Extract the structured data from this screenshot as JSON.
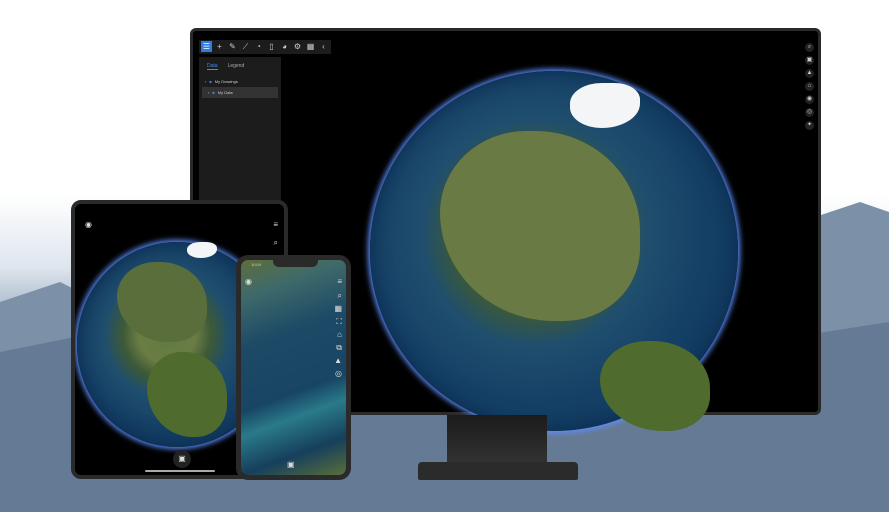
{
  "desktop": {
    "toolbar": [
      {
        "icon": "layers-icon"
      },
      {
        "icon": "plus-icon"
      },
      {
        "icon": "pencil-icon"
      },
      {
        "icon": "ruler-icon"
      },
      {
        "icon": "gauge-icon"
      },
      {
        "icon": "bookmark-icon"
      },
      {
        "icon": "globe-icon"
      },
      {
        "icon": "gear-icon"
      },
      {
        "icon": "grid-icon"
      },
      {
        "icon": "chevron-left-icon"
      }
    ],
    "panel": {
      "tabs": [
        "Data",
        "Legend"
      ],
      "items": [
        "My Drawings",
        "My Data"
      ]
    },
    "right_tools": [
      "search-icon",
      "basemap-icon",
      "north-icon",
      "home-icon",
      "view-icon",
      "locate-icon",
      "compass-icon"
    ]
  },
  "phone": {
    "time": "10:04"
  },
  "colors": {
    "accent": "#2d7be5",
    "glow": "#5d8fff"
  }
}
